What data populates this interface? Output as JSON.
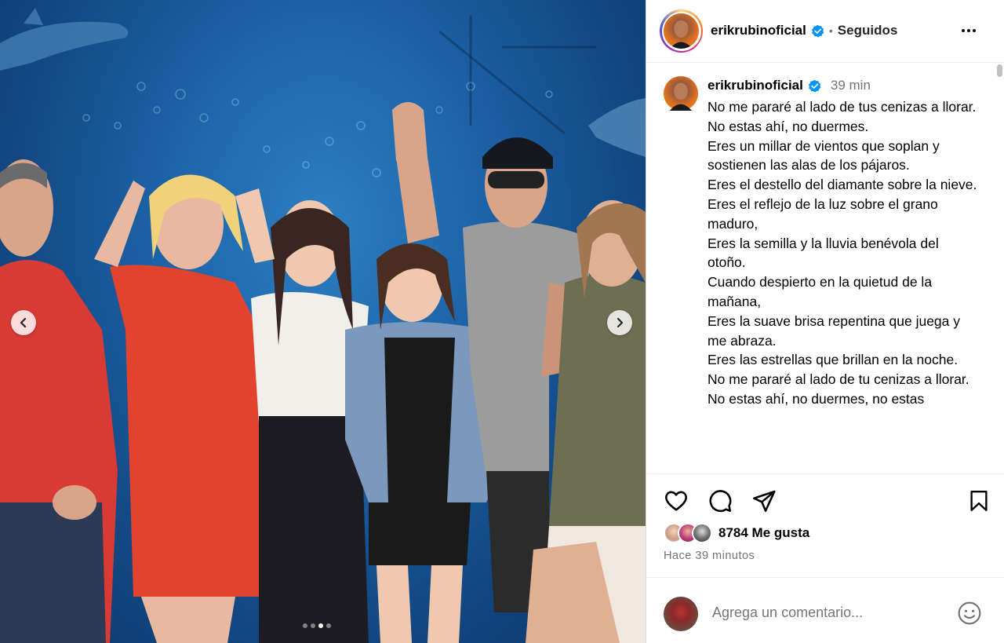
{
  "post": {
    "username": "erikrubinoficial",
    "follow_state": "Seguidos",
    "separator": "•"
  },
  "caption": {
    "username": "erikrubinoficial",
    "time": "39 min",
    "text": "No me pararé al lado de tus cenizas a llorar.\nNo estas ahí, no duermes.\nEres un millar de vientos que soplan y sostienen las alas de los pájaros.\nEres el destello del diamante sobre la nieve.\nEres el reflejo de la luz sobre el grano maduro,\nEres la semilla y la lluvia benévola del otoño.\nCuando despierto en la quietud de la mañana,\nEres la suave brisa repentina que juega y me abraza.\nEres las estrellas que brillan en la noche.\nNo me pararé al lado de tu cenizas a llorar.\nNo estas ahí, no duermes, no estas"
  },
  "carousel": {
    "total": 4,
    "active_index": 2
  },
  "engagement": {
    "likes_text": "8784 Me gusta",
    "time_ago": "Hace 39 minutos"
  },
  "comment": {
    "placeholder": "Agrega un comentario..."
  },
  "icons": {
    "like": "heart-icon",
    "comment": "comment-icon",
    "share": "send-icon",
    "save": "bookmark-icon",
    "emoji": "emoji-icon",
    "more": "more-icon",
    "verified": "verified-badge-icon",
    "prev": "chevron-left-icon",
    "next": "chevron-right-icon"
  },
  "colors": {
    "verified": "#0095f6",
    "secondary_text": "#737373",
    "photo_bg": "#1d63a8"
  }
}
